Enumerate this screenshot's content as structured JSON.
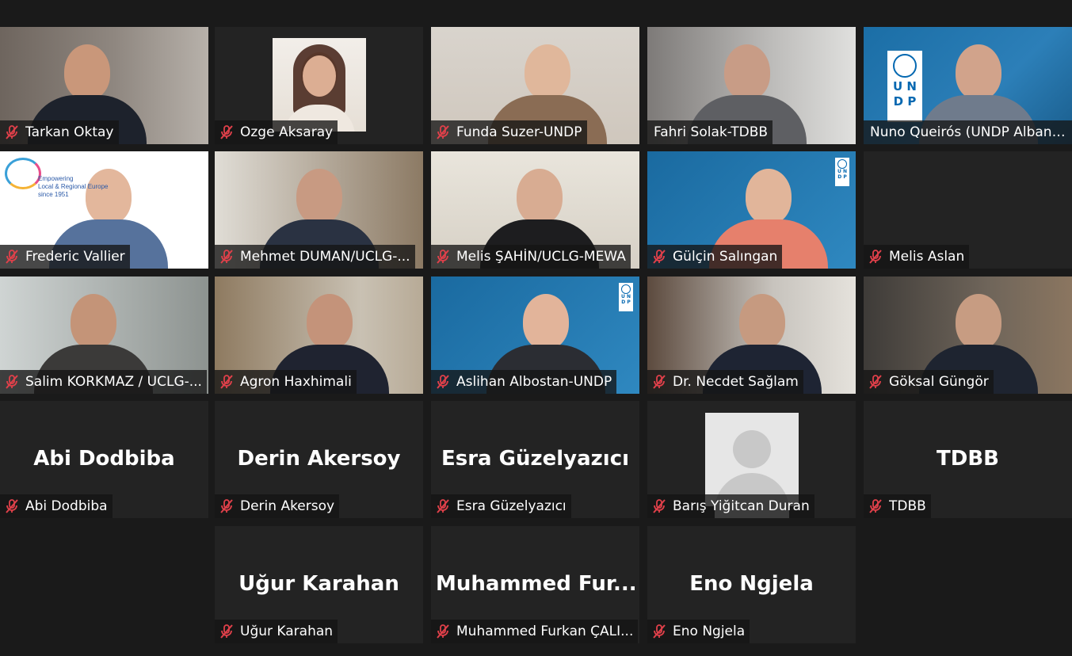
{
  "participants": [
    {
      "name": "Tarkan Oktay",
      "display": "video",
      "muted": true
    },
    {
      "name": "Ozge Aksaray",
      "display": "video",
      "muted": true
    },
    {
      "name": "Funda Suzer-UNDP",
      "display": "video",
      "muted": true
    },
    {
      "name": "Fahri Solak-TDBB",
      "display": "video",
      "muted": false
    },
    {
      "name": "Nuno Queirós (UNDP Albani...",
      "display": "video",
      "muted": false,
      "active_speaker": true
    },
    {
      "name": "Frederic Vallier",
      "display": "video",
      "muted": true
    },
    {
      "name": "Mehmet DUMAN/UCLG-...",
      "display": "video",
      "muted": true
    },
    {
      "name": "Melis ŞAHİN/UCLG-MEWA",
      "display": "video",
      "muted": true
    },
    {
      "name": "Gülçin Salıngan",
      "display": "video",
      "muted": true
    },
    {
      "name": "Melis Aslan",
      "display": "blank",
      "muted": true
    },
    {
      "name": "Salim KORKMAZ / UCLG-...",
      "display": "video",
      "muted": true
    },
    {
      "name": "Agron Haxhimali",
      "display": "video",
      "muted": true
    },
    {
      "name": "Aslihan Albostan-UNDP",
      "display": "video",
      "muted": true
    },
    {
      "name": "Dr. Necdet Sağlam",
      "display": "video",
      "muted": true
    },
    {
      "name": "Göksal Güngör",
      "display": "video",
      "muted": true
    },
    {
      "name": "Abi Dodbiba",
      "display": "name",
      "big_label": "Abi Dodbiba",
      "muted": true
    },
    {
      "name": "Derin Akersoy",
      "display": "name",
      "big_label": "Derin Akersoy",
      "muted": true
    },
    {
      "name": "Esra Güzelyazıcı",
      "display": "name",
      "big_label": "Esra Güzelyazıcı",
      "muted": true
    },
    {
      "name": "Barış Yiğitcan Duran",
      "display": "avatar",
      "muted": true
    },
    {
      "name": "TDBB",
      "display": "name",
      "big_label": "TDBB",
      "muted": true
    },
    {
      "name": "Uğur Karahan",
      "display": "name",
      "big_label": "Uğur Karahan",
      "muted": true
    },
    {
      "name": "Muhammed Furkan ÇALI...",
      "display": "name",
      "big_label": "Muhammed  Fur...",
      "muted": true
    },
    {
      "name": "Eno Ngjela",
      "display": "name",
      "big_label": "Eno Ngjela",
      "muted": true
    }
  ],
  "logos": {
    "undp_top": "U N D P",
    "cities_note_1": "Empowering",
    "cities_note_2": "Local & Regional Europe",
    "cities_note_3": "since 1951"
  },
  "colors": {
    "active_outline": "#cfe57a",
    "muted_icon": "#e0404a",
    "undp_blue": "#0468b1"
  }
}
